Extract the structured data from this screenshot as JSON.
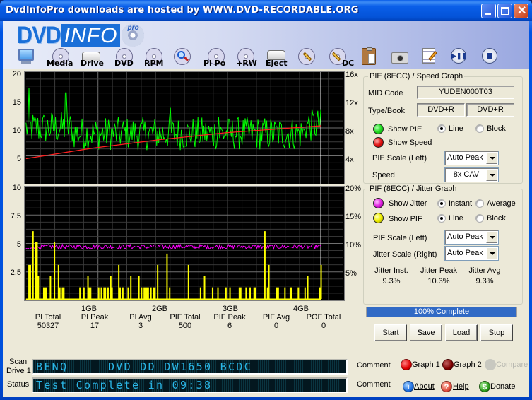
{
  "window": {
    "title": "DvdInfoPro downloads are hosted by WWW.DVD-RECORDABLE.ORG",
    "controls": [
      "minimize",
      "maximize",
      "close"
    ]
  },
  "logo": {
    "dvd": "DVD",
    "info": "INFO",
    "pro": "pro"
  },
  "toolbar": [
    {
      "id": "computer",
      "label": "",
      "icon": "monitor-icon"
    },
    {
      "id": "media",
      "label": "Media",
      "icon": "disc-icon"
    },
    {
      "id": "drive",
      "label": "Drive",
      "icon": "drive-icon"
    },
    {
      "id": "dvd",
      "label": "DVD",
      "icon": "disc-icon"
    },
    {
      "id": "rpm",
      "label": "RPM",
      "icon": "disc-icon"
    },
    {
      "id": "scan",
      "label": "",
      "icon": "magnifier-disc-icon"
    },
    {
      "id": "pipo",
      "label": "Pi Po",
      "icon": "disc-icon"
    },
    {
      "id": "rw",
      "label": "+RW",
      "icon": "disc-icon"
    },
    {
      "id": "eject",
      "label": "Eject",
      "icon": "drive-icon"
    },
    {
      "id": "burn",
      "label": "",
      "icon": "pencil-disc-icon"
    },
    {
      "id": "dc",
      "label": "DC",
      "icon": "pencil-disc-icon"
    },
    {
      "id": "clipboard",
      "label": "",
      "icon": "clipboard-icon"
    },
    {
      "id": "camera",
      "label": "",
      "icon": "camera-icon"
    },
    {
      "id": "notes",
      "label": "",
      "icon": "notepad-icon"
    },
    {
      "id": "playpause",
      "label": "",
      "icon": "play-pause-icon"
    },
    {
      "id": "stop",
      "label": "",
      "icon": "stop-icon"
    }
  ],
  "chart_data": [
    {
      "type": "line",
      "title": "PIE (8ECC) / Speed Graph",
      "yleft": {
        "ticks": [
          "20",
          "15",
          "10",
          "5"
        ],
        "range": [
          0,
          20
        ]
      },
      "yright": {
        "ticks": [
          "16x",
          "12x",
          "8x",
          "4x"
        ],
        "range": [
          0,
          16
        ]
      },
      "x": {
        "range_gb": [
          0,
          4.7
        ],
        "ticks": [
          "1GB",
          "2GB",
          "3GB",
          "4GB"
        ]
      },
      "grid": true,
      "series": [
        {
          "name": "PIE",
          "color": "#00ff00",
          "description": "noisy line mostly between 6 and 12, peaks ~17 near start, ends ~10",
          "baseline": 9,
          "noise": 3,
          "peaks": [
            [
              0.05,
              17.2
            ],
            [
              0.6,
              16.3
            ],
            [
              2.18,
              13.6
            ],
            [
              2.9,
              12
            ],
            [
              4.55,
              12.2
            ]
          ],
          "end_gb": 4.44
        },
        {
          "name": "Speed",
          "color": "#ff2020",
          "unit": "x",
          "values_x": [
            0,
            1,
            2,
            3,
            4,
            4.44
          ],
          "values": [
            3.6,
            5.1,
            6.3,
            7.3,
            8.0,
            8.3
          ]
        }
      ]
    },
    {
      "type": "line",
      "title": "PIF (8ECC) / Jitter Graph",
      "yleft": {
        "ticks": [
          "10",
          "7.5",
          "5",
          "2.5"
        ],
        "range": [
          0,
          10
        ]
      },
      "yright": {
        "ticks": [
          "20%",
          "15%",
          "10%",
          "5%"
        ],
        "range": [
          0,
          20
        ]
      },
      "x": {
        "range_gb": [
          0,
          4.7
        ],
        "ticks": [
          "1GB",
          "2GB",
          "3GB",
          "4GB"
        ]
      },
      "grid": true,
      "series": [
        {
          "name": "Jitter",
          "color": "#ff00ff",
          "unit": "%",
          "baseline": 9.3,
          "noise": 0.4,
          "end_gb": 4.44
        },
        {
          "name": "PIF",
          "color": "#ffff00",
          "peaks": [
            [
              0.1,
              6
            ],
            [
              0.05,
              3
            ],
            [
              0.15,
              5
            ],
            [
              0.42,
              5
            ],
            [
              0.48,
              3
            ],
            [
              1.4,
              3
            ],
            [
              2.12,
              4
            ],
            [
              2.45,
              3
            ],
            [
              1.97,
              3
            ],
            [
              3.6,
              6
            ],
            [
              3.65,
              3
            ],
            [
              4.44,
              3
            ]
          ],
          "end_gb": 4.44
        }
      ]
    }
  ],
  "stats": {
    "x_ticks": [
      "1GB",
      "2GB",
      "3GB",
      "4GB"
    ],
    "items": [
      {
        "label": "PI Total",
        "value": "50327"
      },
      {
        "label": "PI Peak",
        "value": "17"
      },
      {
        "label": "PI Avg",
        "value": "3"
      },
      {
        "label": "PIF Total",
        "value": "500"
      },
      {
        "label": "PIF Peak",
        "value": "6"
      },
      {
        "label": "PIF Avg",
        "value": "0"
      },
      {
        "label": "POF Total",
        "value": "0"
      }
    ]
  },
  "pie_panel": {
    "title": "PIE (8ECC) / Speed Graph",
    "mid_label": "MID Code",
    "mid_value": "YUDEN000T03",
    "typebook_label": "Type/Book",
    "type_value": "DVD+R",
    "book_value": "DVD+R",
    "show_pie": "Show PIE",
    "show_speed": "Show Speed",
    "line": "Line",
    "block": "Block",
    "line_selected": true,
    "pie_scale_label": "PIE Scale (Left)",
    "pie_scale_value": "Auto Peak",
    "speed_label": "Speed",
    "speed_value": "8x CAV",
    "colors": {
      "pie": "#22dd22",
      "speed": "#e01010"
    }
  },
  "pif_panel": {
    "title": "PIF (8ECC) / Jitter Graph",
    "show_jitter": "Show Jitter",
    "show_pif": "Show PIF",
    "instant": "Instant",
    "average": "Average",
    "line": "Line",
    "block": "Block",
    "pif_scale_label": "PIF Scale (Left)",
    "pif_scale_value": "Auto Peak",
    "jitter_scale_label": "Jitter Scale (Right)",
    "jitter_scale_value": "Auto Peak",
    "jitter_inst_label": "Jitter Inst.",
    "jitter_inst_value": "9.3%",
    "jitter_peak_label": "Jitter Peak",
    "jitter_peak_value": "10.3%",
    "jitter_avg_label": "Jitter Avg",
    "jitter_avg_value": "9.3%",
    "colors": {
      "jitter": "#e020e0",
      "pif": "#f0f000"
    }
  },
  "progress": {
    "label": "100% Complete",
    "value": 1.0
  },
  "buttons": {
    "start": "Start",
    "save": "Save",
    "load": "Load",
    "stop": "Stop"
  },
  "bottom": {
    "scan_drive_label_1": "Scan",
    "scan_drive_label_2": "Drive 1",
    "scan_drive_value": "BENQ     DVD DD DW1650 BCDC",
    "status_label": "Status",
    "status_value": "Test Complete in 09:38",
    "comment_1": "Comment",
    "comment_2": "Comment",
    "graph1": "Graph 1",
    "graph2": "Graph 2",
    "compare": "Compare",
    "about": "About",
    "help": "Help",
    "donate": "Donate"
  }
}
